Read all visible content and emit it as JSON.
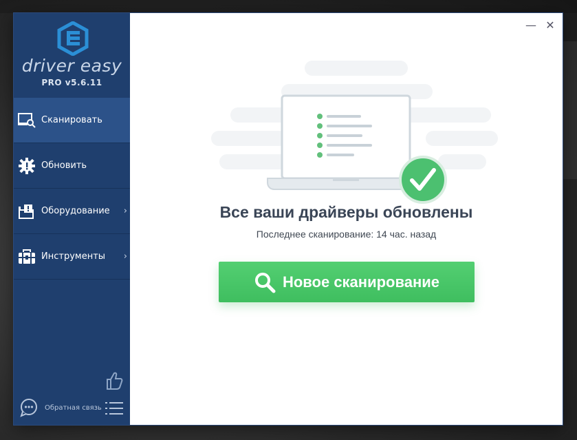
{
  "app": {
    "brand": "driver easy",
    "version": "PRO v5.6.11"
  },
  "sidebar": {
    "items": [
      {
        "label": "Сканировать",
        "icon": "scan-icon",
        "active": true,
        "has_submenu": false
      },
      {
        "label": "Обновить",
        "icon": "update-gear-icon",
        "active": false,
        "has_submenu": false
      },
      {
        "label": "Оборудование",
        "icon": "hardware-icon",
        "active": false,
        "has_submenu": true
      },
      {
        "label": "Инструменты",
        "icon": "toolbox-icon",
        "active": false,
        "has_submenu": true
      }
    ],
    "feedback_label": "Обратная связь",
    "chevron": "›"
  },
  "main": {
    "heading": "Все ваши драйверы обновлены",
    "subheading": "Последнее сканирование: 14 час. назад",
    "scan_button_label": "Новое сканирование"
  },
  "window_controls": {
    "minimize": "—",
    "close": "✕"
  },
  "colors": {
    "sidebar_bg": "#1f3f6e",
    "sidebar_active": "#2c5289",
    "accent_green": "#48c468",
    "logo_blue": "#2b8fd6"
  }
}
